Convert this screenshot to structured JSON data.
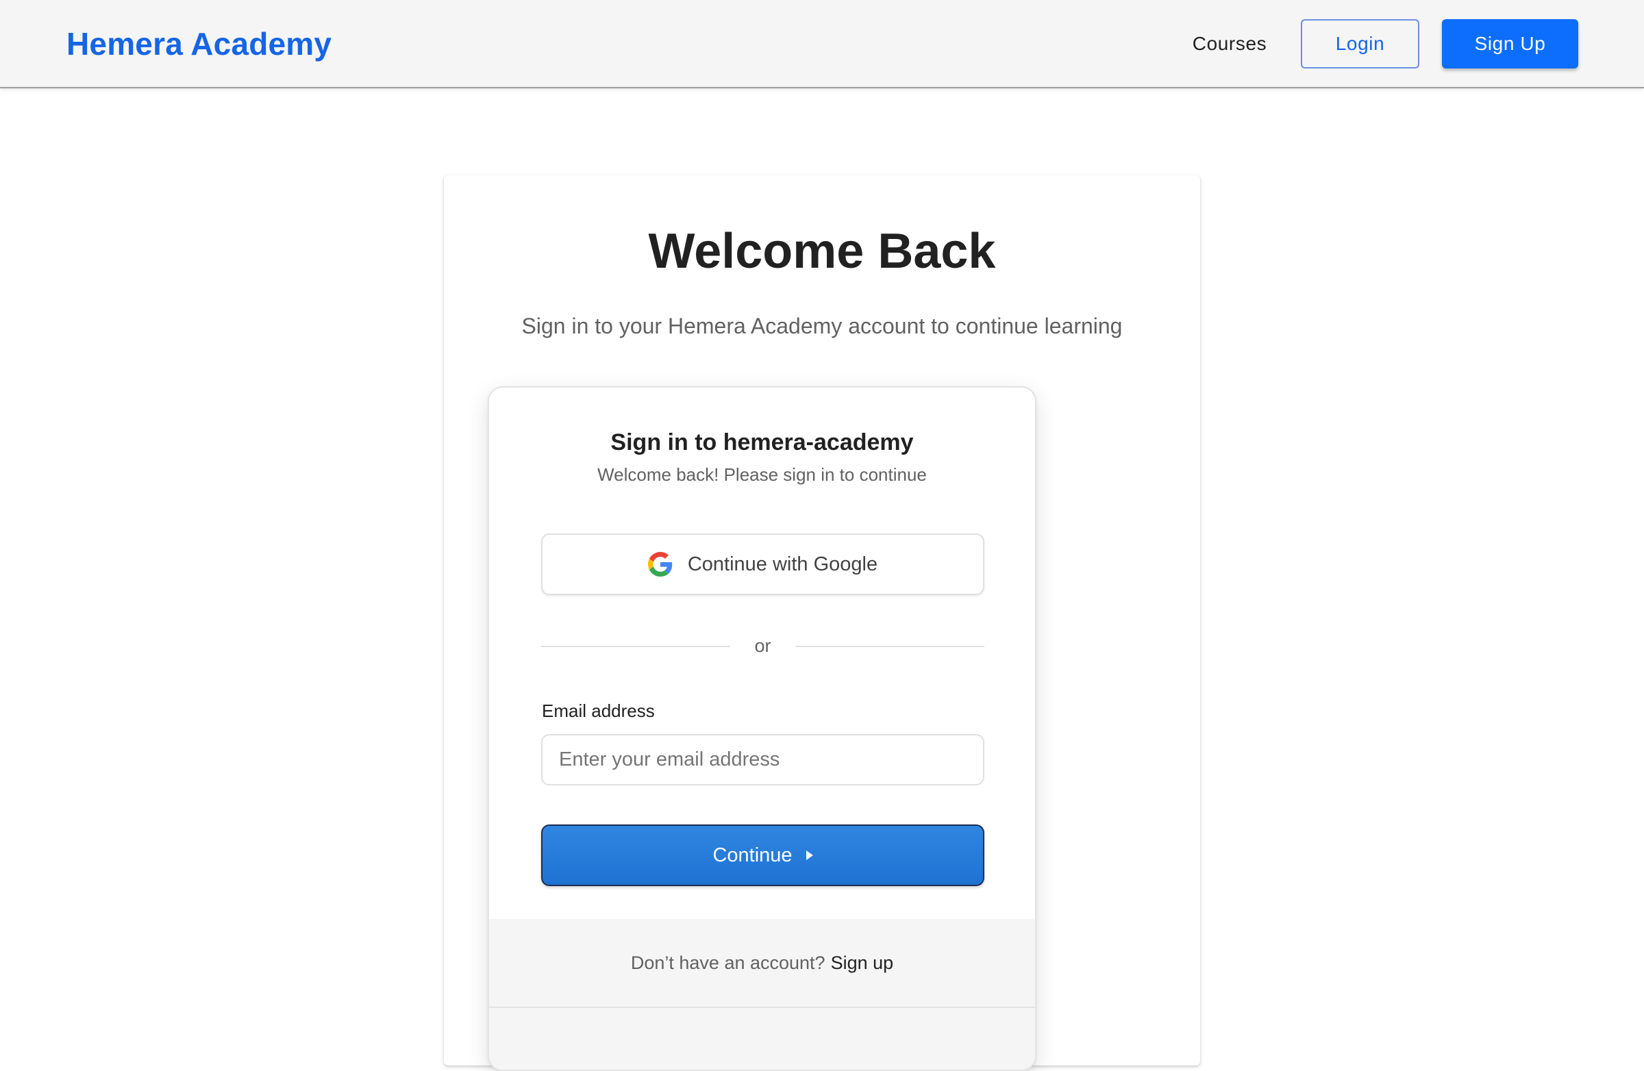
{
  "navbar": {
    "brand": "Hemera Academy",
    "courses_label": "Courses",
    "login_label": "Login",
    "signup_label": "Sign Up"
  },
  "page": {
    "title": "Welcome Back",
    "subtitle": "Sign in to your Hemera Academy account to continue learning"
  },
  "signin": {
    "title": "Sign in to hemera-academy",
    "subtitle": "Welcome back! Please sign in to continue",
    "google_label": "Continue with Google",
    "divider_text": "or",
    "email_label": "Email address",
    "email_placeholder": "Enter your email address",
    "email_value": "",
    "continue_label": "Continue",
    "footer_text": "Don’t have an account?",
    "footer_link": "Sign up"
  },
  "icons": {
    "google": "google-g-icon",
    "continue_arrow": "caret-right-icon"
  },
  "colors": {
    "brand": "#1565e6",
    "primary_button": "#0d6efd",
    "continue_button": "#2f86e0",
    "navbar_bg": "#f5f5f5"
  }
}
